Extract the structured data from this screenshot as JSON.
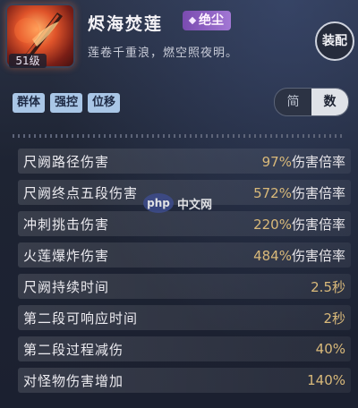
{
  "skill": {
    "name": "烬海焚莲",
    "rarity": "绝尘",
    "description": "莲卷千重浪，燃空照夜明。",
    "level": "51级",
    "icon": "flame-sword-icon"
  },
  "equip_button": "装配",
  "tags": [
    "群体",
    "强控",
    "位移"
  ],
  "view_toggle": {
    "options": [
      "简",
      "数"
    ],
    "selected": "数"
  },
  "attributes": [
    {
      "label": "尺阙路径伤害",
      "number": "97%",
      "suffix": "伤害倍率"
    },
    {
      "label": "尺阙终点五段伤害",
      "number": "572%",
      "suffix": "伤害倍率"
    },
    {
      "label": "冲刺挑击伤害",
      "number": "220%",
      "suffix": "伤害倍率"
    },
    {
      "label": "火莲爆炸伤害",
      "number": "484%",
      "suffix": "伤害倍率"
    },
    {
      "label": "尺阙持续时间",
      "number": "2.5秒",
      "suffix": ""
    },
    {
      "label": "第二段可响应时间",
      "number": "2秒",
      "suffix": ""
    },
    {
      "label": "第二段过程减伤",
      "number": "40%",
      "suffix": ""
    },
    {
      "label": "对怪物伤害增加",
      "number": "140%",
      "suffix": ""
    }
  ],
  "watermark": {
    "logo": "php",
    "text": "中文网"
  }
}
